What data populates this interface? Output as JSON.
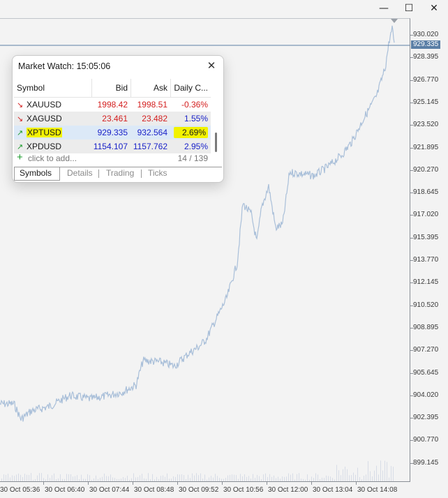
{
  "window": {
    "minimize_glyph": "—",
    "maximize_glyph": "☐",
    "close_glyph": "✕"
  },
  "chart": {
    "line_color": "#a9bfd9",
    "current_price": "929.335",
    "price_labels": [
      "930.020",
      "928.395",
      "926.770",
      "925.145",
      "923.520",
      "921.895",
      "920.270",
      "918.645",
      "917.020",
      "915.395",
      "913.770",
      "912.145",
      "910.520",
      "908.895",
      "907.270",
      "905.645",
      "904.020",
      "902.395",
      "900.770",
      "899.145"
    ],
    "time_labels": [
      "30 Oct 05:36",
      "30 Oct 06:40",
      "30 Oct 07:44",
      "30 Oct 08:48",
      "30 Oct 09:52",
      "30 Oct 10:56",
      "30 Oct 12:00",
      "30 Oct 13:04",
      "30 Oct 14:08"
    ]
  },
  "market_watch": {
    "title": "Market Watch: 15:05:06",
    "close_glyph": "✕",
    "columns": {
      "symbol": "Symbol",
      "bid": "Bid",
      "ask": "Ask",
      "change": "Daily C..."
    },
    "rows": [
      {
        "symbol": "XAUUSD",
        "bid": "1998.42",
        "ask": "1998.51",
        "change": "-0.36%",
        "dir": "down",
        "arrow": "↘"
      },
      {
        "symbol": "XAGUSD",
        "bid": "23.461",
        "ask": "23.482",
        "change": "1.55%",
        "dir": "down",
        "arrow": "↘"
      },
      {
        "symbol": "XPTUSD",
        "bid": "929.335",
        "ask": "932.564",
        "change": "2.69%",
        "dir": "up",
        "arrow": "↗"
      },
      {
        "symbol": "XPDUSD",
        "bid": "1154.107",
        "ask": "1157.762",
        "change": "2.95%",
        "dir": "up",
        "arrow": "↗"
      }
    ],
    "add_label": "click to add...",
    "add_glyph": "+",
    "count": "14 / 139",
    "tabs": [
      "Symbols",
      "Details",
      "Trading",
      "Ticks"
    ],
    "colors": {
      "down": "#d42020",
      "up": "#1a22c8",
      "up_arrow": "#1a9a2a",
      "highlight": "#f2f200",
      "selected_row": "#dce9f7"
    }
  }
}
